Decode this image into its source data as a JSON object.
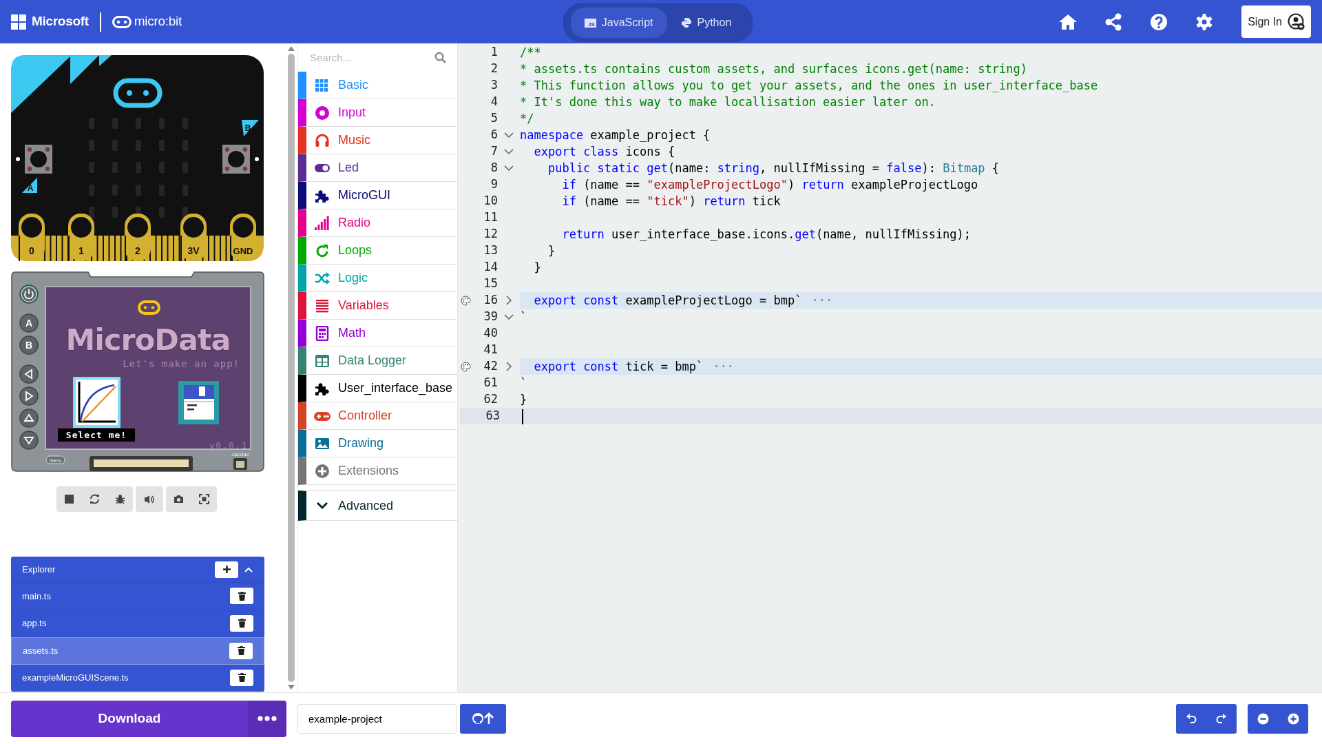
{
  "header": {
    "brand": "Microsoft",
    "product": "micro:bit",
    "language_tabs": [
      {
        "label": "JavaScript",
        "badge": "JS",
        "selected": true
      },
      {
        "label": "Python",
        "selected": false
      }
    ],
    "sign_in": "Sign In"
  },
  "simulator": {
    "pins": [
      "0",
      "1",
      "2",
      "3V",
      "GND"
    ],
    "buttons": [
      "A",
      "B"
    ],
    "arcade": {
      "title": "MicroData",
      "subtitle": "Let's make an app!",
      "caption": "Select me!",
      "version": "v0.0.1",
      "keys": [
        "A",
        "B"
      ],
      "menu": "menu",
      "connector": "Jacdac"
    }
  },
  "explorer": {
    "title": "Explorer",
    "files": [
      {
        "name": "main.ts",
        "selected": false
      },
      {
        "name": "app.ts",
        "selected": false
      },
      {
        "name": "assets.ts",
        "selected": true
      },
      {
        "name": "exampleMicroGUIScene.ts",
        "selected": false
      }
    ]
  },
  "toolbox": {
    "search_placeholder": "Search...",
    "categories": [
      {
        "label": "Basic",
        "kind": "grid",
        "color": "#1e90ff"
      },
      {
        "label": "Input",
        "kind": "target",
        "color": "#d400d4"
      },
      {
        "label": "Music",
        "kind": "headphones",
        "color": "#e63022"
      },
      {
        "label": "Led",
        "kind": "toggle",
        "color": "#5c2d91"
      },
      {
        "label": "MicroGUI",
        "kind": "puzzle",
        "color": "#0b0b7a"
      },
      {
        "label": "Radio",
        "kind": "signal",
        "color": "#e3008c"
      },
      {
        "label": "Loops",
        "kind": "loop",
        "color": "#00aa00"
      },
      {
        "label": "Logic",
        "kind": "shuffle",
        "color": "#00a4a6"
      },
      {
        "label": "Variables",
        "kind": "lines",
        "color": "#dc143c"
      },
      {
        "label": "Math",
        "kind": "calculator",
        "color": "#9400d3"
      },
      {
        "label": "Data Logger",
        "kind": "table",
        "color": "#378273"
      },
      {
        "label": "User_interface_base",
        "kind": "puzzle",
        "color": "#000000"
      },
      {
        "label": "Controller",
        "kind": "gamepad",
        "color": "#d54322"
      },
      {
        "label": "Drawing",
        "kind": "image",
        "color": "#0b6e94"
      },
      {
        "label": "Extensions",
        "kind": "plus",
        "color": "#757575"
      }
    ],
    "advanced": {
      "label": "Advanced",
      "color": "#00272b"
    }
  },
  "editor": {
    "lines": [
      {
        "number": "1",
        "tokens": [
          {
            "kind": "comment",
            "text": "/**"
          }
        ]
      },
      {
        "number": "2",
        "tokens": [
          {
            "kind": "comment",
            "text": "* assets.ts contains custom assets, and surfaces icons.get(name: string)"
          }
        ]
      },
      {
        "number": "3",
        "tokens": [
          {
            "kind": "comment",
            "text": "* This function allows you to get your assets, and the ones in user_interface_base"
          }
        ]
      },
      {
        "number": "4",
        "tokens": [
          {
            "kind": "comment",
            "text": "* It's done this way to make locallisation easier later on."
          }
        ]
      },
      {
        "number": "5",
        "tokens": [
          {
            "kind": "comment",
            "text": "*/"
          }
        ]
      },
      {
        "number": "6",
        "expanded": true,
        "tokens": [
          {
            "kind": "keyword",
            "text": "namespace"
          },
          {
            "kind": "plain",
            "text": " example_project {"
          }
        ]
      },
      {
        "number": "7",
        "expanded": true,
        "tokens": [
          {
            "kind": "keyword",
            "text": "  export"
          },
          {
            "kind": "keyword",
            "text": " class"
          },
          {
            "kind": "plain",
            "text": " icons {"
          }
        ]
      },
      {
        "number": "8",
        "expanded": true,
        "tokens": [
          {
            "kind": "keyword",
            "text": "    public"
          },
          {
            "kind": "keyword",
            "text": " static"
          },
          {
            "kind": "function",
            "text": " get"
          },
          {
            "kind": "plain",
            "text": "(name: "
          },
          {
            "kind": "keyword",
            "text": "string"
          },
          {
            "kind": "plain",
            "text": ", nullIfMissing = "
          },
          {
            "kind": "keyword",
            "text": "false"
          },
          {
            "kind": "plain",
            "text": "): "
          },
          {
            "kind": "type",
            "text": "Bitmap"
          },
          {
            "kind": "plain",
            "text": " {"
          }
        ]
      },
      {
        "number": "9",
        "tokens": [
          {
            "kind": "keyword",
            "text": "      if"
          },
          {
            "kind": "plain",
            "text": " (name == "
          },
          {
            "kind": "string",
            "text": "\"exampleProjectLogo\""
          },
          {
            "kind": "plain",
            "text": ") "
          },
          {
            "kind": "keyword",
            "text": "return"
          },
          {
            "kind": "plain",
            "text": " exampleProjectLogo"
          }
        ]
      },
      {
        "number": "10",
        "tokens": [
          {
            "kind": "keyword",
            "text": "      if"
          },
          {
            "kind": "plain",
            "text": " (name == "
          },
          {
            "kind": "string",
            "text": "\"tick\""
          },
          {
            "kind": "plain",
            "text": ") "
          },
          {
            "kind": "keyword",
            "text": "return"
          },
          {
            "kind": "plain",
            "text": " tick"
          }
        ]
      },
      {
        "number": "11"
      },
      {
        "number": "12",
        "tokens": [
          {
            "kind": "keyword",
            "text": "      return"
          },
          {
            "kind": "plain",
            "text": " user_interface_base.icons."
          },
          {
            "kind": "function",
            "text": "get"
          },
          {
            "kind": "plain",
            "text": "(name, nullIfMissing);"
          }
        ]
      },
      {
        "number": "13",
        "tokens": [
          {
            "kind": "plain",
            "text": "    }"
          }
        ]
      },
      {
        "number": "14",
        "tokens": [
          {
            "kind": "plain",
            "text": "  }"
          }
        ]
      },
      {
        "number": "15"
      },
      {
        "number": "16",
        "expanded": false,
        "asset": true,
        "tokens": [
          {
            "kind": "keyword",
            "text": "  export"
          },
          {
            "kind": "keyword",
            "text": " const"
          },
          {
            "kind": "plain",
            "text": " exampleProjectLogo = bmp`"
          },
          {
            "kind": "ellipsis",
            "text": "···"
          }
        ]
      },
      {
        "number": "39",
        "expanded": true,
        "tokens": [
          {
            "kind": "plain",
            "text": "`"
          }
        ]
      },
      {
        "number": "40"
      },
      {
        "number": "41"
      },
      {
        "number": "42",
        "expanded": false,
        "asset": true,
        "tokens": [
          {
            "kind": "keyword",
            "text": "  export"
          },
          {
            "kind": "keyword",
            "text": " const"
          },
          {
            "kind": "plain",
            "text": " tick = bmp`"
          },
          {
            "kind": "ellipsis",
            "text": "···"
          }
        ]
      },
      {
        "number": "61",
        "tokens": [
          {
            "kind": "plain",
            "text": "`"
          }
        ]
      },
      {
        "number": "62",
        "tokens": [
          {
            "kind": "plain",
            "text": "}"
          }
        ]
      },
      {
        "number": "63",
        "current": true
      }
    ]
  },
  "footer": {
    "download": "Download",
    "project_name": "example-project"
  }
}
